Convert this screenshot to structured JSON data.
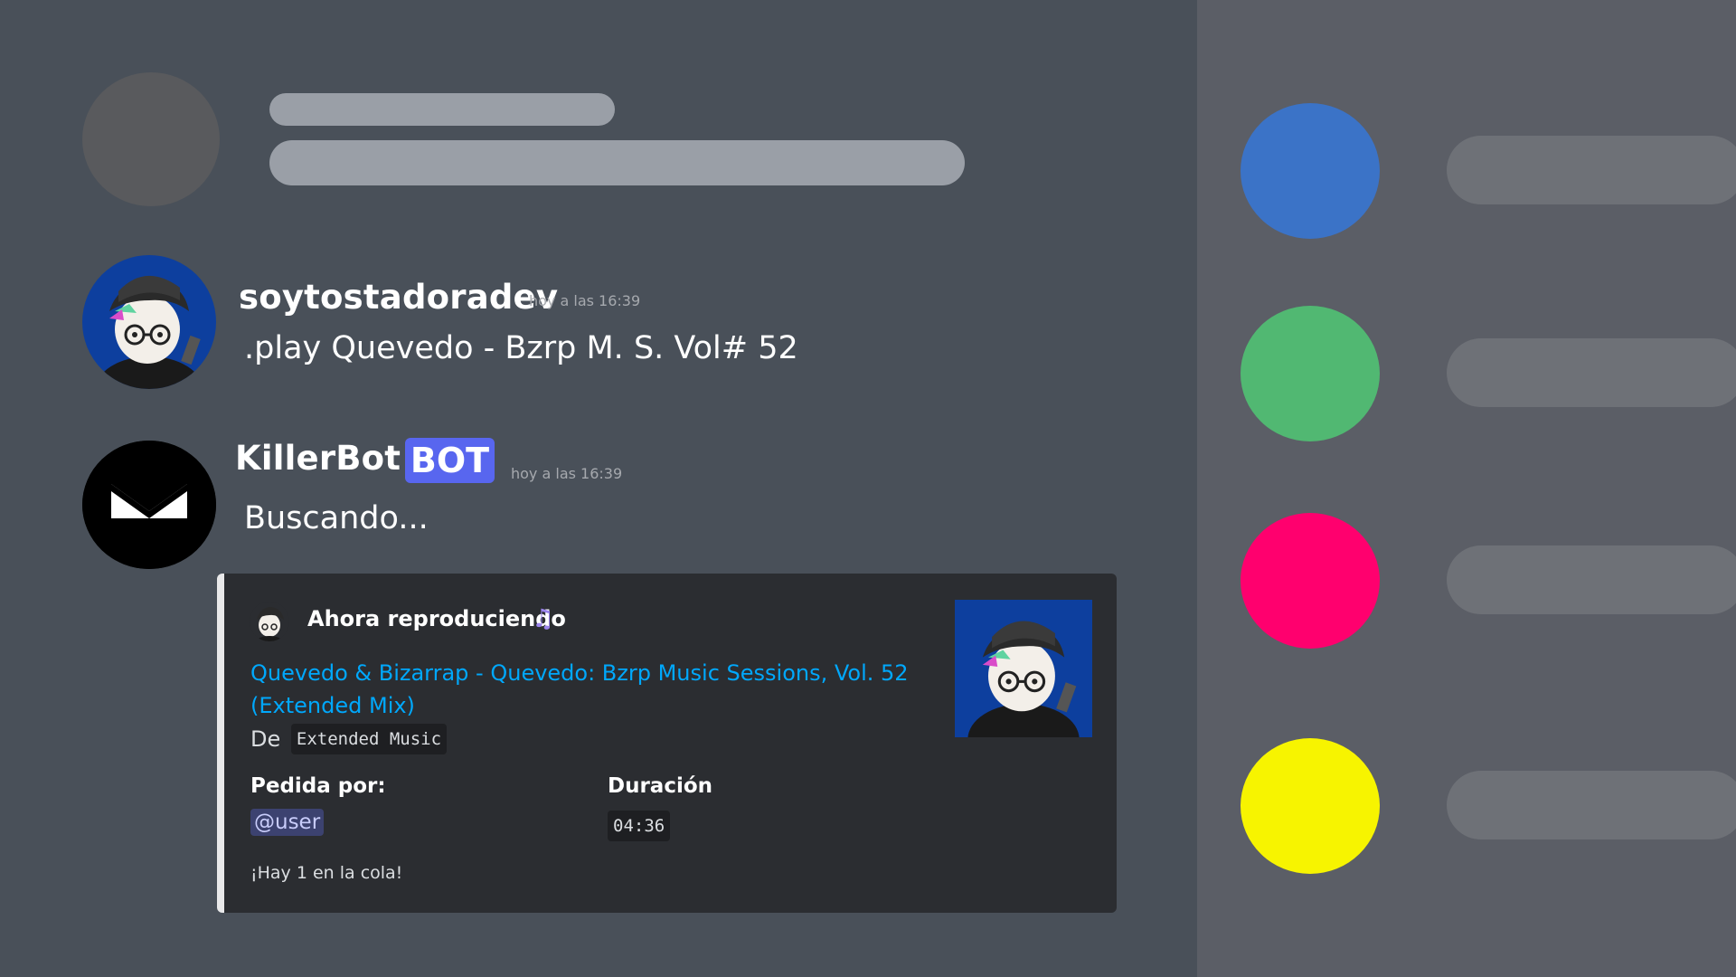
{
  "messages": [
    {
      "username": "soytostadoradev",
      "timestamp": "hoy a las 16:39",
      "text": ".play Quevedo - Bzrp M. S. Vol# 52"
    },
    {
      "username": "KillerBot",
      "badge": "BOT",
      "timestamp": "hoy a las 16:39",
      "text": "Buscando..."
    }
  ],
  "embed": {
    "author": "Ahora reproduciendo",
    "author_icon": "music-note-icon",
    "title": "Quevedo & Bizarrap - Quevedo: Bzrp Music Sessions, Vol. 52 (Extended Mix)",
    "description_prefix": "De",
    "description_code": "Extended Music",
    "fields": [
      {
        "name": "Pedida por:",
        "value": "@user"
      },
      {
        "name": "Duración",
        "value": "04:36"
      }
    ],
    "footer": "¡Hay 1 en la cola!"
  },
  "members": [
    {
      "color": "#3b73c7"
    },
    {
      "color": "#51b872"
    },
    {
      "color": "#ff006e"
    },
    {
      "color": "#f7f400"
    }
  ],
  "colors": {
    "chat_bg": "#495059",
    "sidebar_bg": "#5b5e66",
    "embed_bg": "#2b2d31",
    "link": "#00a8fc",
    "bot_badge": "#5866ef"
  }
}
